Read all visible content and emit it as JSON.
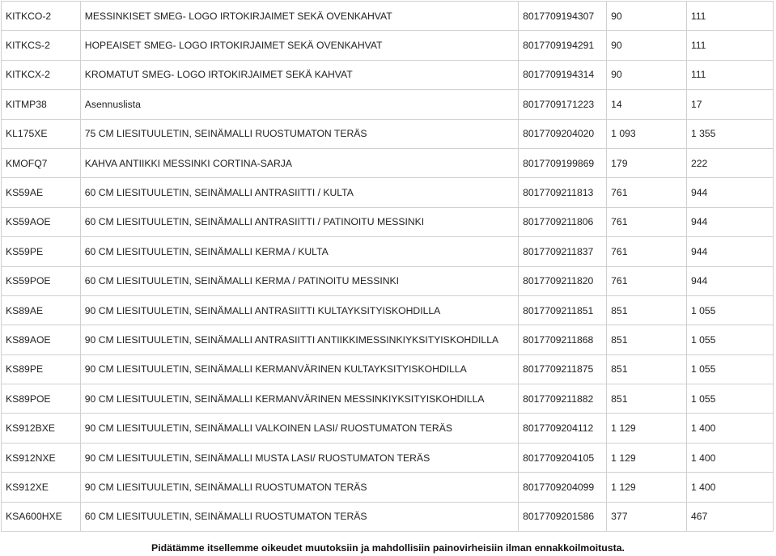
{
  "rows": [
    {
      "code": "KITKCO-2",
      "description": "MESSINKISET SMEG- LOGO IRTOKIRJAIMET SEKÄ OVENKAHVAT",
      "ean": "8017709194307",
      "price1": "90",
      "price2": "111"
    },
    {
      "code": "KITKCS-2",
      "description": "HOPEAISET SMEG- LOGO IRTOKIRJAIMET SEKÄ OVENKAHVAT",
      "ean": "8017709194291",
      "price1": "90",
      "price2": "111"
    },
    {
      "code": "KITKCX-2",
      "description": "KROMATUT SMEG- LOGO IRTOKIRJAIMET SEKÄ KAHVAT",
      "ean": "8017709194314",
      "price1": "90",
      "price2": "111"
    },
    {
      "code": "KITMP38",
      "description": "Asennuslista",
      "ean": "8017709171223",
      "price1": "14",
      "price2": "17"
    },
    {
      "code": "KL175XE",
      "description": "75 CM LIESITUULETIN, SEINÄMALLI RUOSTUMATON TERÄS",
      "ean": "8017709204020",
      "price1": "1 093",
      "price2": "1 355"
    },
    {
      "code": "KMOFQ7",
      "description": "KAHVA ANTIIKKI MESSINKI CORTINA-SARJA",
      "ean": "8017709199869",
      "price1": "179",
      "price2": "222"
    },
    {
      "code": "KS59AE",
      "description": "60 CM LIESITUULETIN, SEINÄMALLI ANTRASIITTI / KULTA",
      "ean": "8017709211813",
      "price1": "761",
      "price2": "944"
    },
    {
      "code": "KS59AOE",
      "description": "60 CM LIESITUULETIN, SEINÄMALLI ANTRASIITTI / PATINOITU MESSINKI",
      "ean": "8017709211806",
      "price1": "761",
      "price2": "944"
    },
    {
      "code": "KS59PE",
      "description": "60 CM LIESITUULETIN, SEINÄMALLI KERMA / KULTA",
      "ean": "8017709211837",
      "price1": "761",
      "price2": "944"
    },
    {
      "code": "KS59POE",
      "description": "60 CM LIESITUULETIN, SEINÄMALLI KERMA / PATINOITU MESSINKI",
      "ean": "8017709211820",
      "price1": "761",
      "price2": "944"
    },
    {
      "code": "KS89AE",
      "description": "90 CM LIESITUULETIN, SEINÄMALLI ANTRASIITTI KULTAYKSITYISKOHDILLA",
      "ean": "8017709211851",
      "price1": "851",
      "price2": "1 055"
    },
    {
      "code": "KS89AOE",
      "description": "90 CM LIESITUULETIN, SEINÄMALLI ANTRASIITTI ANTIIKKIMESSINKIYKSITYISKOHDILLA",
      "ean": "8017709211868",
      "price1": "851",
      "price2": "1 055"
    },
    {
      "code": "KS89PE",
      "description": "90 CM LIESITUULETIN, SEINÄMALLI KERMANVÄRINEN KULTAYKSITYISKOHDILLA",
      "ean": "8017709211875",
      "price1": "851",
      "price2": "1 055"
    },
    {
      "code": "KS89POE",
      "description": "90 CM LIESITUULETIN, SEINÄMALLI KERMANVÄRINEN MESSINKIYKSITYISKOHDILLA",
      "ean": "8017709211882",
      "price1": "851",
      "price2": "1 055"
    },
    {
      "code": "KS912BXE",
      "description": "90 CM LIESITUULETIN, SEINÄMALLI VALKOINEN LASI/ RUOSTUMATON TERÄS",
      "ean": "8017709204112",
      "price1": "1 129",
      "price2": "1 400"
    },
    {
      "code": "KS912NXE",
      "description": "90 CM LIESITUULETIN, SEINÄMALLI MUSTA LASI/ RUOSTUMATON TERÄS",
      "ean": "8017709204105",
      "price1": "1 129",
      "price2": "1 400"
    },
    {
      "code": "KS912XE",
      "description": "90 CM LIESITUULETIN, SEINÄMALLI RUOSTUMATON TERÄS",
      "ean": "8017709204099",
      "price1": "1 129",
      "price2": "1 400"
    },
    {
      "code": "KSA600HXE",
      "description": "60 CM LIESITUULETIN, SEINÄMALLI RUOSTUMATON TERÄS",
      "ean": "8017709201586",
      "price1": "377",
      "price2": "467"
    }
  ],
  "footer": {
    "note": "Pidätämme itsellemme oikeudet muutoksiin ja mahdollisiin painovirheisiin ilman ennakkoilmoitusta."
  }
}
